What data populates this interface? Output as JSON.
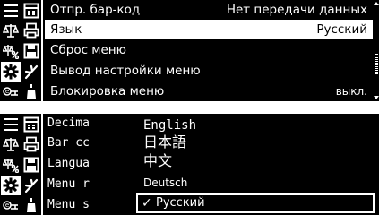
{
  "colors": {
    "background": "#000000",
    "foreground": "#ffffff"
  },
  "icon_grid": [
    [
      "list-icon",
      "calendar-icon"
    ],
    [
      "balance-icon",
      "printer-icon"
    ],
    [
      "balance-percent-icon",
      "save-icon"
    ],
    [
      "gear-icon",
      "calibration-icon"
    ],
    [
      "key-menu-icon",
      "bottle-icon"
    ]
  ],
  "top_menu": {
    "rows": [
      {
        "label": "Отпр. бар-код",
        "value": "Нет передачи данных"
      },
      {
        "label": "Язык",
        "value": "Русский"
      },
      {
        "label": "Сброс меню",
        "value": ""
      },
      {
        "label": "Вывод настройки меню",
        "value": ""
      },
      {
        "label": "Блокировка меню",
        "value": "выкл."
      }
    ]
  },
  "bottom_list": {
    "rows": [
      "Decima",
      "Bar cc",
      "Langua",
      "Menu r",
      "Menu s"
    ]
  },
  "language_popup": {
    "options": [
      "English",
      "日本語",
      "中文",
      "Deutsch",
      "Русский"
    ],
    "selected": "Русский",
    "check_mark": "✓"
  }
}
